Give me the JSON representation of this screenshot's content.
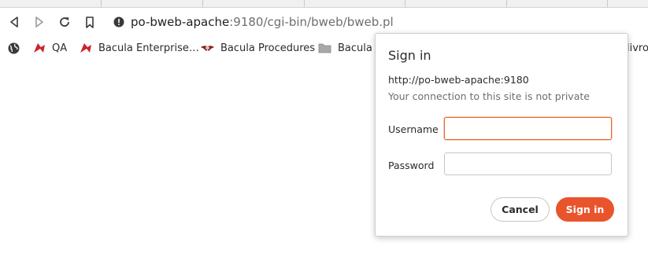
{
  "browser": {
    "url_host": "po-bweb-apache",
    "url_path": ":9180/cgi-bin/bweb/bweb.pl",
    "nav_icons": [
      "back-icon",
      "forward-icon",
      "reload-icon",
      "bookmark-icon",
      "site-info-icon"
    ]
  },
  "bookmarks": {
    "items": [
      {
        "label": "QA",
        "icon": "red-bookmark-icon"
      },
      {
        "label": "Bacula Enterprise…",
        "icon": "red-bookmark-icon"
      },
      {
        "label": "Bacula Procedures",
        "icon": "bat-icon"
      },
      {
        "label": "Bacula",
        "icon": "folder-icon"
      }
    ],
    "overflow_text": "livros"
  },
  "dialog": {
    "title": "Sign in",
    "origin": "http://po-bweb-apache:9180",
    "warning": "Your connection to this site is not private",
    "username_label": "Username",
    "username_value": "",
    "password_label": "Password",
    "password_value": "",
    "cancel_label": "Cancel",
    "signin_label": "Sign in"
  },
  "colors": {
    "accent": "#e9542d",
    "focus_border": "#e9672a"
  }
}
